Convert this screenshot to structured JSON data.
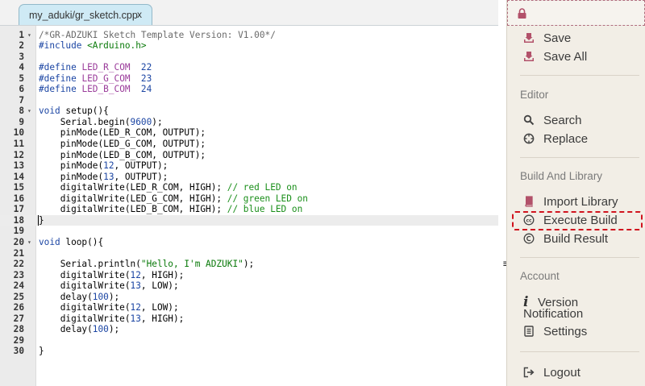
{
  "tab": {
    "label": "my_aduki/gr_sketch.cpp",
    "close": "x"
  },
  "code_lines": [
    {
      "n": "1",
      "fold": "▾",
      "segs": [
        [
          "cm",
          "/*GR-ADZUKI Sketch Template Version: V1.00*/"
        ]
      ]
    },
    {
      "n": "2",
      "fold": "",
      "segs": [
        [
          "pp",
          "#include "
        ],
        [
          "s",
          "<Arduino.h>"
        ]
      ]
    },
    {
      "n": "3",
      "fold": "",
      "segs": []
    },
    {
      "n": "4",
      "fold": "",
      "segs": [
        [
          "pp",
          "#define "
        ],
        [
          "m",
          "LED_R_COM"
        ],
        [
          "",
          "  "
        ],
        [
          "n",
          "22"
        ]
      ]
    },
    {
      "n": "5",
      "fold": "",
      "segs": [
        [
          "pp",
          "#define "
        ],
        [
          "m",
          "LED_G_COM"
        ],
        [
          "",
          "  "
        ],
        [
          "n",
          "23"
        ]
      ]
    },
    {
      "n": "6",
      "fold": "",
      "segs": [
        [
          "pp",
          "#define "
        ],
        [
          "m",
          "LED_B_COM"
        ],
        [
          "",
          "  "
        ],
        [
          "n",
          "24"
        ]
      ]
    },
    {
      "n": "7",
      "fold": "",
      "segs": []
    },
    {
      "n": "8",
      "fold": "▾",
      "segs": [
        [
          "k",
          "void"
        ],
        [
          "",
          " setup(){"
        ]
      ]
    },
    {
      "n": "9",
      "fold": "",
      "segs": [
        [
          "",
          "    Serial.begin("
        ],
        [
          "n",
          "9600"
        ],
        [
          "",
          ");"
        ]
      ]
    },
    {
      "n": "10",
      "fold": "",
      "segs": [
        [
          "",
          "    pinMode(LED_R_COM, OUTPUT);"
        ]
      ]
    },
    {
      "n": "11",
      "fold": "",
      "segs": [
        [
          "",
          "    pinMode(LED_G_COM, OUTPUT);"
        ]
      ]
    },
    {
      "n": "12",
      "fold": "",
      "segs": [
        [
          "",
          "    pinMode(LED_B_COM, OUTPUT);"
        ]
      ]
    },
    {
      "n": "13",
      "fold": "",
      "segs": [
        [
          "",
          "    pinMode("
        ],
        [
          "n",
          "12"
        ],
        [
          "",
          ", OUTPUT);"
        ]
      ]
    },
    {
      "n": "14",
      "fold": "",
      "segs": [
        [
          "",
          "    pinMode("
        ],
        [
          "n",
          "13"
        ],
        [
          "",
          ", OUTPUT);"
        ]
      ]
    },
    {
      "n": "15",
      "fold": "",
      "segs": [
        [
          "",
          "    digitalWrite(LED_R_COM, HIGH); "
        ],
        [
          "c",
          "// red LED on"
        ]
      ]
    },
    {
      "n": "16",
      "fold": "",
      "segs": [
        [
          "",
          "    digitalWrite(LED_G_COM, HIGH); "
        ],
        [
          "c",
          "// green LED on"
        ]
      ]
    },
    {
      "n": "17",
      "fold": "",
      "segs": [
        [
          "",
          "    digitalWrite(LED_B_COM, HIGH); "
        ],
        [
          "c",
          "// blue LED on"
        ]
      ]
    },
    {
      "n": "18",
      "fold": "",
      "segs": [
        [
          "cur",
          "}"
        ]
      ]
    },
    {
      "n": "19",
      "fold": "",
      "segs": []
    },
    {
      "n": "20",
      "fold": "▾",
      "segs": [
        [
          "k",
          "void"
        ],
        [
          "",
          " loop(){"
        ]
      ]
    },
    {
      "n": "21",
      "fold": "",
      "segs": []
    },
    {
      "n": "22",
      "fold": "",
      "segs": [
        [
          "",
          "    Serial.println("
        ],
        [
          "s",
          "\"Hello, I'm ADZUKI\""
        ],
        [
          "",
          ");"
        ]
      ]
    },
    {
      "n": "23",
      "fold": "",
      "segs": [
        [
          "",
          "    digitalWrite("
        ],
        [
          "n",
          "12"
        ],
        [
          "",
          ", HIGH);"
        ]
      ]
    },
    {
      "n": "24",
      "fold": "",
      "segs": [
        [
          "",
          "    digitalWrite("
        ],
        [
          "n",
          "13"
        ],
        [
          "",
          ", LOW);"
        ]
      ]
    },
    {
      "n": "25",
      "fold": "",
      "segs": [
        [
          "",
          "    delay("
        ],
        [
          "n",
          "100"
        ],
        [
          "",
          ");"
        ]
      ]
    },
    {
      "n": "26",
      "fold": "",
      "segs": [
        [
          "",
          "    digitalWrite("
        ],
        [
          "n",
          "12"
        ],
        [
          "",
          ", LOW);"
        ]
      ]
    },
    {
      "n": "27",
      "fold": "",
      "segs": [
        [
          "",
          "    digitalWrite("
        ],
        [
          "n",
          "13"
        ],
        [
          "",
          ", HIGH);"
        ]
      ]
    },
    {
      "n": "28",
      "fold": "",
      "segs": [
        [
          "",
          "    delay("
        ],
        [
          "n",
          "100"
        ],
        [
          "",
          ");"
        ]
      ]
    },
    {
      "n": "29",
      "fold": "",
      "segs": []
    },
    {
      "n": "30",
      "fold": "",
      "segs": [
        [
          "",
          "}"
        ]
      ]
    }
  ],
  "active_line": "18",
  "splitter": {
    "handle": "≡"
  },
  "sidebar": {
    "save": "Save",
    "save_all": "Save All",
    "editor_heading": "Editor",
    "search": "Search",
    "replace": "Replace",
    "build_heading": "Build And Library",
    "import_library": "Import Library",
    "execute_build": "Execute Build",
    "build_result": "Build Result",
    "account_heading": "Account",
    "version_line1": "Version",
    "version_line2": "Notification",
    "settings": "Settings",
    "logout": "Logout"
  },
  "colors": {
    "accent": "#b2516a",
    "highlight": "#d0141e",
    "sidebar_bg": "#f2eee6",
    "tab_bg": "#cfeaf5"
  },
  "icons": {
    "lock": "lock-icon",
    "save": "tray-download-icon",
    "save_all": "tray-download-icon",
    "search": "magnifier-icon",
    "replace": "crosshair-icon",
    "import_library": "book-icon",
    "execute_build": "cc-circle-icon",
    "build_result": "copyright-icon",
    "version": "info-icon",
    "settings": "document-list-icon",
    "logout": "sign-out-icon"
  }
}
